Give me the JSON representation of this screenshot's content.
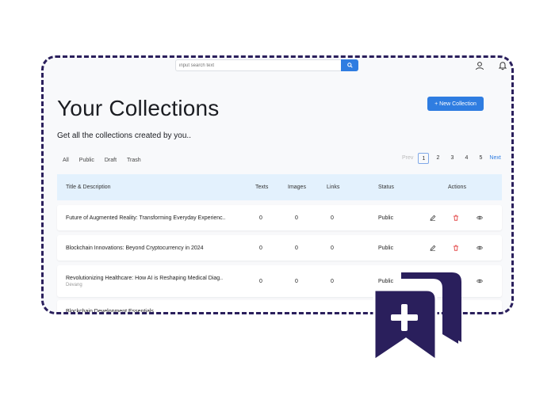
{
  "search": {
    "placeholder": "input search text"
  },
  "page": {
    "title": "Your Collections",
    "subtitle": "Get all the collections created by you..",
    "add_button": "+ New Collection"
  },
  "filters": [
    "All",
    "Public",
    "Draft",
    "Trash"
  ],
  "pagination": {
    "prev": "Prev",
    "pages": [
      "1",
      "2",
      "3",
      "4",
      "5"
    ],
    "current": "1",
    "next": "Next"
  },
  "table": {
    "headers": [
      "Title & Description",
      "Texts",
      "Images",
      "Links",
      "Status",
      "Actions"
    ],
    "rows": [
      {
        "title": "Future of Augmented Reality: Transforming Everyday Experienc..",
        "author": "",
        "texts": "0",
        "images": "0",
        "links": "0",
        "status": "Public"
      },
      {
        "title": "Blockchain Innovations: Beyond Cryptocurrency in 2024",
        "author": "",
        "texts": "0",
        "images": "0",
        "links": "0",
        "status": "Public"
      },
      {
        "title": "Revolutionizing Healthcare: How AI is Reshaping Medical Diag..",
        "author": "Devang",
        "texts": "0",
        "images": "0",
        "links": "0",
        "status": "Public"
      },
      {
        "title": "Blockchain Development Essentials",
        "author": "",
        "texts": "",
        "images": "",
        "links": "",
        "status": ""
      }
    ]
  },
  "colors": {
    "accent": "#2f7de1",
    "frame": "#2a1f5c",
    "header_bg": "#e3f1fd",
    "delete": "#e03131",
    "badge": "#2a1f5c"
  },
  "icons": [
    "search-icon",
    "user-icon",
    "bell-icon",
    "edit-icon",
    "trash-icon",
    "eye-icon",
    "bookmark-add-icon"
  ]
}
